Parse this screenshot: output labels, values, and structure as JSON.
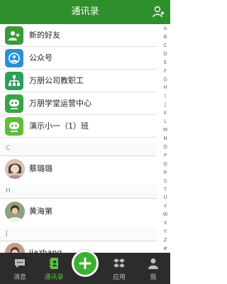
{
  "header": {
    "title": "通讯录"
  },
  "top_rows": [
    {
      "label": "新的好友",
      "icon": "add-friend-icon",
      "color": "#3a9a3a"
    },
    {
      "label": "公众号",
      "icon": "public-account-icon",
      "color": "#2a90d2"
    },
    {
      "label": "万朋公司教职工",
      "icon": "org-chart-icon",
      "color": "#2e9e5b"
    },
    {
      "label": "万朋学堂运营中心",
      "icon": "group-icon",
      "color": "#3aa34b"
    },
    {
      "label": "演示小一（1）班",
      "icon": "class-icon",
      "color": "#63bd3a"
    }
  ],
  "sections": [
    {
      "letter": "C",
      "contacts": [
        "蔡璐璐"
      ]
    },
    {
      "letter": "H",
      "contacts": [
        "黄海第"
      ]
    },
    {
      "letter": "J",
      "contacts": [
        "jiazhang"
      ]
    }
  ],
  "index_letters": [
    "A",
    "B",
    "C",
    "D",
    "E",
    "F",
    "G",
    "H",
    "I",
    "J",
    "K",
    "L",
    "M",
    "N",
    "O",
    "P",
    "Q",
    "R",
    "S",
    "T",
    "U",
    "V",
    "W",
    "X",
    "Y",
    "Z",
    "#"
  ],
  "tabs": [
    {
      "label": "消息",
      "icon": "chat-bubble-icon",
      "active": false
    },
    {
      "label": "通讯录",
      "icon": "contacts-book-icon",
      "active": true
    },
    {
      "label": "应用",
      "icon": "apps-icon",
      "active": false
    },
    {
      "label": "我",
      "icon": "person-icon",
      "active": false
    }
  ],
  "colors": {
    "header_bg": "#2f8f2d",
    "tabbar_bg": "#2c2c2c",
    "active_tab": "#5bc236",
    "fab": "#3fae34"
  }
}
